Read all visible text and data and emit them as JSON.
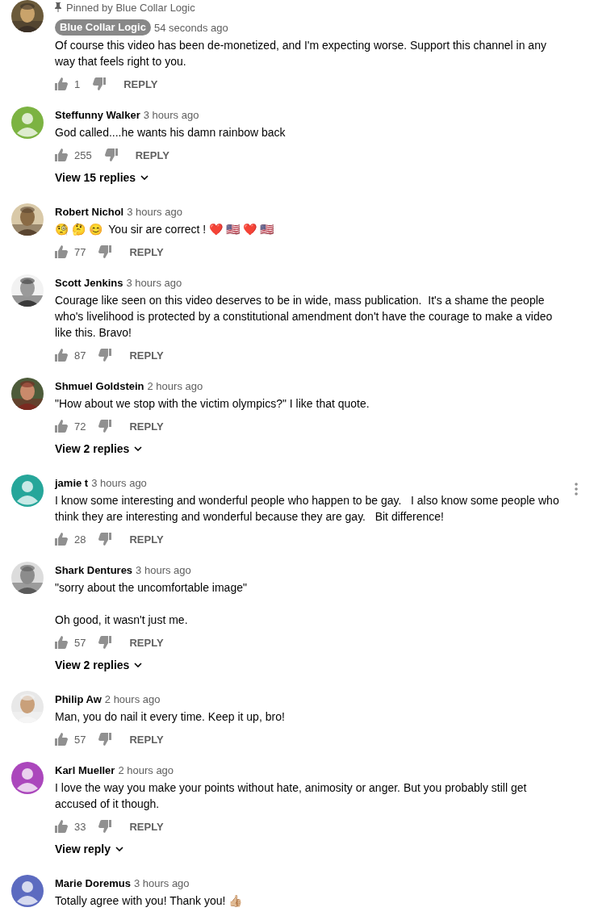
{
  "comments": [
    {
      "pinned_label": "Pinned by Blue Collar Logic",
      "owner": true,
      "author": "Blue Collar Logic",
      "time": "54 seconds ago",
      "text": "Of course this video has been de-monetized, and I'm expecting worse. Support this channel in any way that feels right to you.",
      "likes": "1",
      "reply": "REPLY",
      "menu_visible": false
    },
    {
      "owner": false,
      "author": "Steffunny Walker",
      "time": "3 hours ago",
      "avatar": {
        "kind": "default",
        "color": "#7cb342"
      },
      "text": "God called....he wants his damn rainbow back",
      "likes": "255",
      "reply": "REPLY",
      "replies_link": "View 15 replies",
      "menu_visible": false
    },
    {
      "owner": false,
      "author": "Robert Nichol",
      "time": "3 hours ago",
      "text": "🧐 🤔 😊  You sir are correct ! ❤️ 🇺🇸 ❤️ 🇺🇸",
      "likes": "77",
      "reply": "REPLY",
      "menu_visible": false
    },
    {
      "owner": false,
      "author": "Scott Jenkins",
      "time": "3 hours ago",
      "text": "Courage like seen on this video deserves to be in wide, mass publication.  It's a shame the people who's livelihood is protected by a constitutional amendment don't have the courage to make a video like this. Bravo!",
      "likes": "87",
      "reply": "REPLY",
      "menu_visible": false
    },
    {
      "owner": false,
      "author": "Shmuel Goldstein",
      "time": "2 hours ago",
      "text": "\"How about we stop with the victim olympics?\" I like that quote.",
      "likes": "72",
      "reply": "REPLY",
      "replies_link": "View 2 replies",
      "menu_visible": false
    },
    {
      "owner": false,
      "author": "jamie t",
      "time": "3 hours ago",
      "avatar": {
        "kind": "default",
        "color": "#26a69a"
      },
      "text": "I know some interesting and wonderful people who happen to be gay.   I also know some people who think they are interesting and wonderful because they are gay.   Bit difference!",
      "likes": "28",
      "reply": "REPLY",
      "menu_visible": true
    },
    {
      "owner": false,
      "author": "Shark Dentures",
      "time": "3 hours ago",
      "text": "\"sorry about the uncomfortable image\"\n\nOh good, it wasn't just me.",
      "likes": "57",
      "reply": "REPLY",
      "replies_link": "View 2 replies",
      "menu_visible": false
    },
    {
      "owner": false,
      "author": "Philip Aw",
      "time": "2 hours ago",
      "text": "Man, you do nail it every time. Keep it up, bro!",
      "likes": "57",
      "reply": "REPLY",
      "menu_visible": false
    },
    {
      "owner": false,
      "author": "Karl Mueller",
      "time": "2 hours ago",
      "avatar": {
        "kind": "default",
        "color": "#ab47bc"
      },
      "text": "I love the way you make your points without hate, animosity or anger. But you probably still get accused of it though.",
      "likes": "33",
      "reply": "REPLY",
      "replies_link": "View reply",
      "menu_visible": false
    },
    {
      "owner": false,
      "author": "Marie Doremus",
      "time": "3 hours ago",
      "avatar": {
        "kind": "default",
        "color": "#5c6bc0"
      },
      "text": "Totally agree with you! Thank you! 👍🏼",
      "menu_visible": false
    }
  ]
}
